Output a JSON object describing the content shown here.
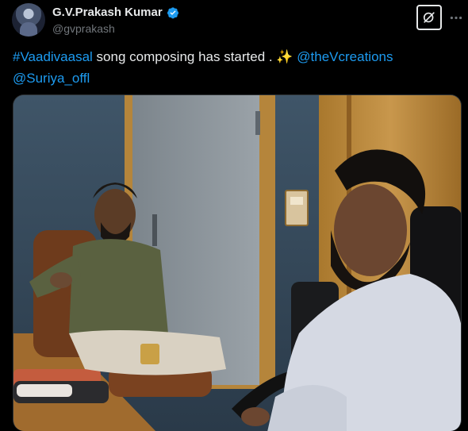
{
  "author": {
    "display_name": "G.V.Prakash Kumar",
    "handle": "@gvprakash"
  },
  "tweet": {
    "hashtag": "#Vaadivaasal",
    "text": " song composing has started . ",
    "sparkle": "✨",
    "mention1": "@theVcreations",
    "mention2": "@Suriya_offl"
  },
  "icons": {
    "verified": "verified-badge-icon",
    "grok": "grok-icon",
    "more": "more-options-icon"
  },
  "colors": {
    "link": "#1d9bf0",
    "verified": "#1d9bf0",
    "background": "#000000"
  },
  "media": {
    "type": "photo"
  }
}
